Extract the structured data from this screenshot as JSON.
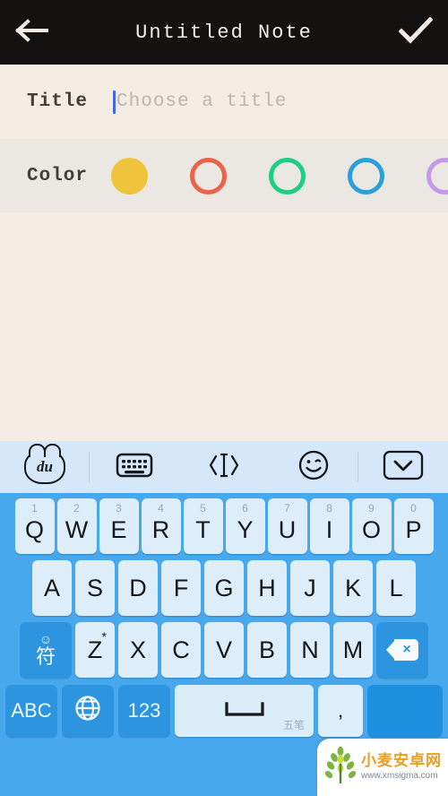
{
  "appbar": {
    "back_icon": "arrow-left-icon",
    "title": "Untitled Note",
    "done_icon": "check-icon",
    "bg": "#141210",
    "fg": "#F3EDE6"
  },
  "title_row": {
    "label": "Title",
    "placeholder": "Choose a title",
    "value": "",
    "caret_color": "#3D6BE8",
    "bg": "#F5EDE4"
  },
  "color_row": {
    "label": "Color",
    "bg": "#EBE8E3",
    "swatches": [
      {
        "name": "yellow",
        "hex": "#F0C33C",
        "selected": true
      },
      {
        "name": "orange",
        "hex": "#E8644A",
        "selected": false
      },
      {
        "name": "green",
        "hex": "#1ECE84",
        "selected": false
      },
      {
        "name": "blue",
        "hex": "#2A9FD8",
        "selected": false
      },
      {
        "name": "purple",
        "hex": "#C49BE8",
        "selected": false
      }
    ]
  },
  "note_body": {
    "text": "",
    "bg": "#F5EDE4"
  },
  "keyboard_toolbar": {
    "bg": "#D5E7F8",
    "items": [
      {
        "name": "baidu-logo-icon",
        "label": "du"
      },
      {
        "name": "keyboard-icon",
        "label": "⌨"
      },
      {
        "name": "cursor-move-icon",
        "label": "‹I›"
      },
      {
        "name": "emoji-icon",
        "label": "☺"
      },
      {
        "name": "hide-keyboard-icon",
        "label": "⌄"
      }
    ]
  },
  "keyboard": {
    "bg": "#48A8EE",
    "key_bg": "#DEEDFA",
    "func_key_bg": "#2D95E0",
    "row1": [
      {
        "letter": "Q",
        "num": "1"
      },
      {
        "letter": "W",
        "num": "2"
      },
      {
        "letter": "E",
        "num": "3"
      },
      {
        "letter": "R",
        "num": "4"
      },
      {
        "letter": "T",
        "num": "5"
      },
      {
        "letter": "Y",
        "num": "6"
      },
      {
        "letter": "U",
        "num": "7"
      },
      {
        "letter": "I",
        "num": "8"
      },
      {
        "letter": "O",
        "num": "9"
      },
      {
        "letter": "P",
        "num": "0"
      }
    ],
    "row2": [
      {
        "letter": "A"
      },
      {
        "letter": "S"
      },
      {
        "letter": "D"
      },
      {
        "letter": "F"
      },
      {
        "letter": "G"
      },
      {
        "letter": "H"
      },
      {
        "letter": "J"
      },
      {
        "letter": "K"
      },
      {
        "letter": "L"
      }
    ],
    "row3": {
      "symbol_key": {
        "emoji": "☺",
        "label": "符"
      },
      "letters": [
        {
          "letter": "Z",
          "star": "*"
        },
        {
          "letter": "X"
        },
        {
          "letter": "C"
        },
        {
          "letter": "V"
        },
        {
          "letter": "B"
        },
        {
          "letter": "N"
        },
        {
          "letter": "M"
        }
      ],
      "backspace": {
        "label": "×"
      }
    },
    "row4": {
      "abc": "ABC",
      "globe": "⊕",
      "num": "123",
      "space_glyph": "⌴",
      "space_sub": "五笔",
      "comma": ",",
      "enter": ""
    }
  },
  "watermark": {
    "cn": "小麦安卓网",
    "url": "www.xmsigma.com",
    "logo_icon": "wheat-logo-icon",
    "cn_color": "#E8A01E"
  }
}
